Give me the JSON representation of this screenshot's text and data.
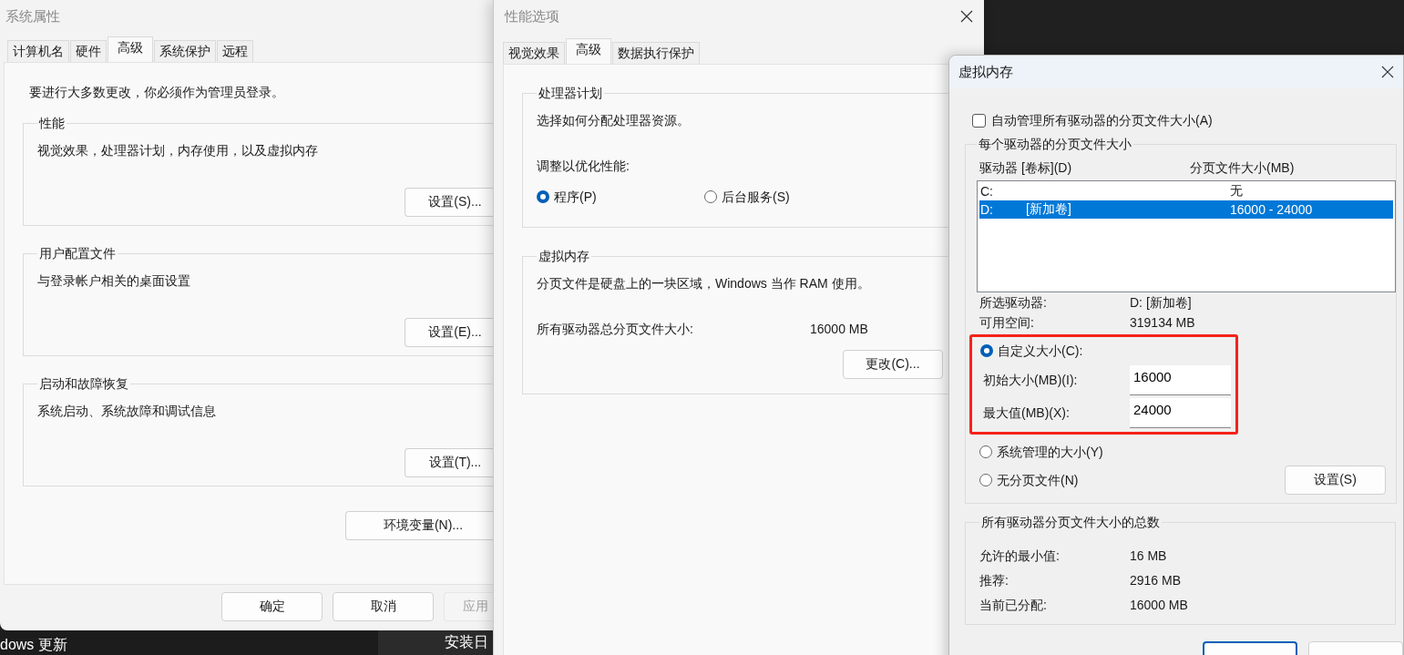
{
  "system_properties": {
    "title": "系统属性",
    "tabs": [
      {
        "label": "计算机名",
        "selected": false
      },
      {
        "label": "硬件",
        "selected": false
      },
      {
        "label": "高级",
        "selected": true
      },
      {
        "label": "系统保护",
        "selected": false
      },
      {
        "label": "远程",
        "selected": false
      }
    ],
    "note": "要进行大多数更改，你必须作为管理员登录。",
    "groups": [
      {
        "legend": "性能",
        "description": "视觉效果，处理器计划，内存使用，以及虚拟内存",
        "button": "设置(S)..."
      },
      {
        "legend": "用户配置文件",
        "description": "与登录帐户相关的桌面设置",
        "button": "设置(E)..."
      },
      {
        "legend": "启动和故障恢复",
        "description": "系统启动、系统故障和调试信息",
        "button": "设置(T)..."
      }
    ],
    "env_button": "环境变量(N)...",
    "buttons": [
      {
        "label": "确定",
        "disabled": false
      },
      {
        "label": "取消",
        "disabled": false
      },
      {
        "label": "应用",
        "disabled": true
      }
    ]
  },
  "performance_options": {
    "title": "性能选项",
    "tabs": [
      {
        "label": "视觉效果",
        "selected": false
      },
      {
        "label": "高级",
        "selected": true
      },
      {
        "label": "数据执行保护",
        "selected": false
      }
    ],
    "processor_group": {
      "legend": "处理器计划",
      "description": "选择如何分配处理器资源。",
      "prompt": "调整以优化性能:",
      "options": [
        {
          "label": "程序(P)",
          "selected": true
        },
        {
          "label": "后台服务(S)",
          "selected": false
        }
      ]
    },
    "memory_group": {
      "legend": "虚拟内存",
      "description": "分页文件是硬盘上的一块区域，Windows 当作 RAM 使用。",
      "total_label": "所有驱动器总分页文件大小:",
      "total_value": "16000 MB",
      "button": "更改(C)..."
    }
  },
  "virtual_memory": {
    "title": "虚拟内存",
    "auto_manage": {
      "label": "自动管理所有驱动器的分页文件大小(A)",
      "checked": false
    },
    "drive_legend": "每个驱动器的分页文件大小",
    "columns": [
      "驱动器 [卷标](D)",
      "分页文件大小(MB)"
    ],
    "drives": [
      {
        "drive": "C:",
        "size": "无",
        "selected": false
      },
      {
        "drive": "D:",
        "volume": "[新加卷]",
        "size": "16000 - 24000",
        "selected": true
      }
    ],
    "info": [
      {
        "label": "所选驱动器:",
        "value": "D:  [新加卷]"
      },
      {
        "label": "可用空间:",
        "value": "319134 MB"
      }
    ],
    "size_options": [
      {
        "kind": "custom",
        "label": "自定义大小(C):",
        "selected": true
      },
      {
        "kind": "system",
        "label": "系统管理的大小(Y)",
        "selected": false
      },
      {
        "kind": "none",
        "label": "无分页文件(N)",
        "selected": false
      }
    ],
    "size_fields": [
      {
        "label": "初始大小(MB)(I):",
        "value": "16000"
      },
      {
        "label": "最大值(MB)(X):",
        "value": "24000"
      }
    ],
    "set_button": "设置(S)",
    "totals_legend": "所有驱动器分页文件大小的总数",
    "totals": [
      {
        "label": "允许的最小值:",
        "value": "16 MB"
      },
      {
        "label": "推荐:",
        "value": "2916 MB"
      },
      {
        "label": "当前已分配:",
        "value": "16000 MB"
      }
    ],
    "buttons": [
      {
        "default": true
      },
      {
        "default": false
      }
    ]
  },
  "taskbar": {
    "left_text": "dows 更新",
    "right_text": "安装日"
  }
}
